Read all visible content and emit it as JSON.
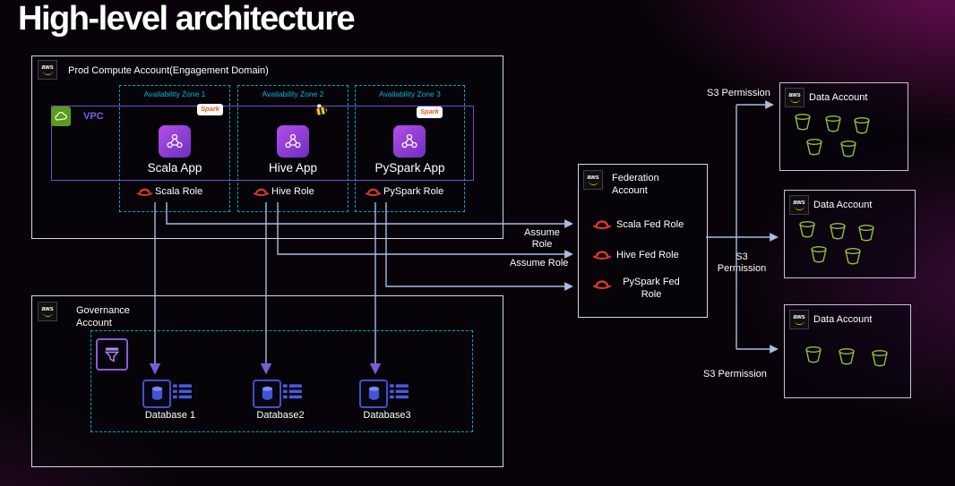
{
  "title": "High-level architecture",
  "icons": {
    "aws_logo_text": "aws"
  },
  "prod_account": {
    "label": "Prod Compute Account(Engagement Domain)",
    "vpc_label": "VPC",
    "spark_badge": "Spark",
    "zones": [
      {
        "label": "Availability Zone 1",
        "app_label": "Scala App",
        "role_label": "Scala Role",
        "engine_icon": "spark-logo"
      },
      {
        "label": "Availability Zone 2",
        "app_label": "Hive App",
        "role_label": "Hive Role",
        "engine_icon": "hive-bee"
      },
      {
        "label": "Availability Zone 3",
        "app_label": "PySpark App",
        "role_label": "PySpark  Role",
        "engine_icon": "spark-logo"
      }
    ]
  },
  "federation_account": {
    "label": "Federation Account",
    "roles": [
      {
        "label": "Scala Fed Role"
      },
      {
        "label": "Hive Fed Role"
      },
      {
        "label": "PySpark Fed Role"
      }
    ]
  },
  "governance_account": {
    "label": "Governance Account",
    "databases": [
      {
        "label": "Database 1"
      },
      {
        "label": "Database2"
      },
      {
        "label": "Database3"
      }
    ]
  },
  "data_accounts": [
    {
      "label": "Data Account",
      "bucket_count": 5
    },
    {
      "label": "Data Account",
      "bucket_count": 5
    },
    {
      "label": "Data Account",
      "bucket_count": 3
    }
  ],
  "edge_labels": {
    "assume_role_top": "Assume Role",
    "assume_role_bottom": "Assume Role",
    "s3_permission_top": "S3 Permission",
    "s3_permission_middle": "S3 Permission",
    "s3_permission_bottom": "S3 Permission"
  },
  "colors": {
    "background": "#070308",
    "accent_cyan": "#00a8c8",
    "accent_purple": "#7a4fd8",
    "role_red": "#d93a25",
    "bucket_green": "#8fbf3f",
    "database_blue": "#4254d8",
    "connector": "#a9bce4",
    "spark_orange": "#e25a1c"
  }
}
